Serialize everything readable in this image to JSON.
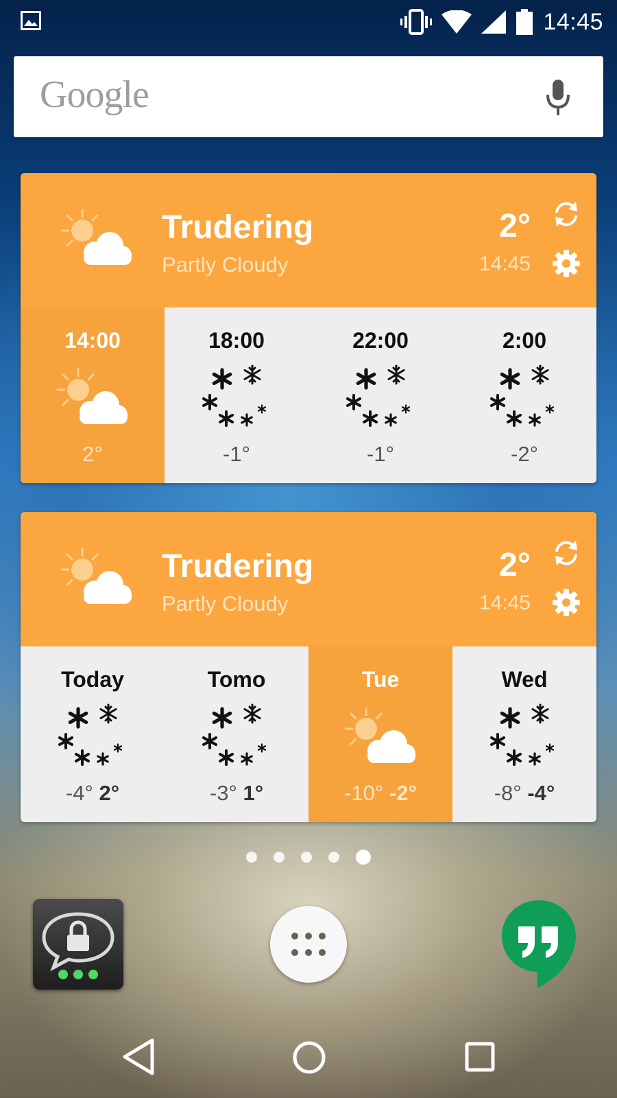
{
  "status_bar": {
    "time": "14:45"
  },
  "search": {
    "logo": "Google"
  },
  "hourly_widget": {
    "city": "Trudering",
    "condition": "Partly Cloudy",
    "temp": "2°",
    "updated": "14:45",
    "items": [
      {
        "label": "14:00",
        "temp": "2°",
        "icon": "partly-cloudy"
      },
      {
        "label": "18:00",
        "temp": "-1°",
        "icon": "snow"
      },
      {
        "label": "22:00",
        "temp": "-1°",
        "icon": "snow"
      },
      {
        "label": "2:00",
        "temp": "-2°",
        "icon": "snow"
      }
    ]
  },
  "daily_widget": {
    "city": "Trudering",
    "condition": "Partly Cloudy",
    "temp": "2°",
    "updated": "14:45",
    "items": [
      {
        "label": "Today",
        "low": "-4°",
        "high": "2°",
        "icon": "snow"
      },
      {
        "label": "Tomo",
        "low": "-3°",
        "high": "1°",
        "icon": "snow"
      },
      {
        "label": "Tue",
        "low": "-10°",
        "high": "-2°",
        "icon": "partly-cloudy"
      },
      {
        "label": "Wed",
        "low": "-8°",
        "high": "-4°",
        "icon": "snow"
      }
    ]
  },
  "colors": {
    "header": "#fca63f",
    "active_column": "#f6a23d",
    "forecast_bg": "#eeeeee",
    "hangouts": "#0f9d58"
  }
}
